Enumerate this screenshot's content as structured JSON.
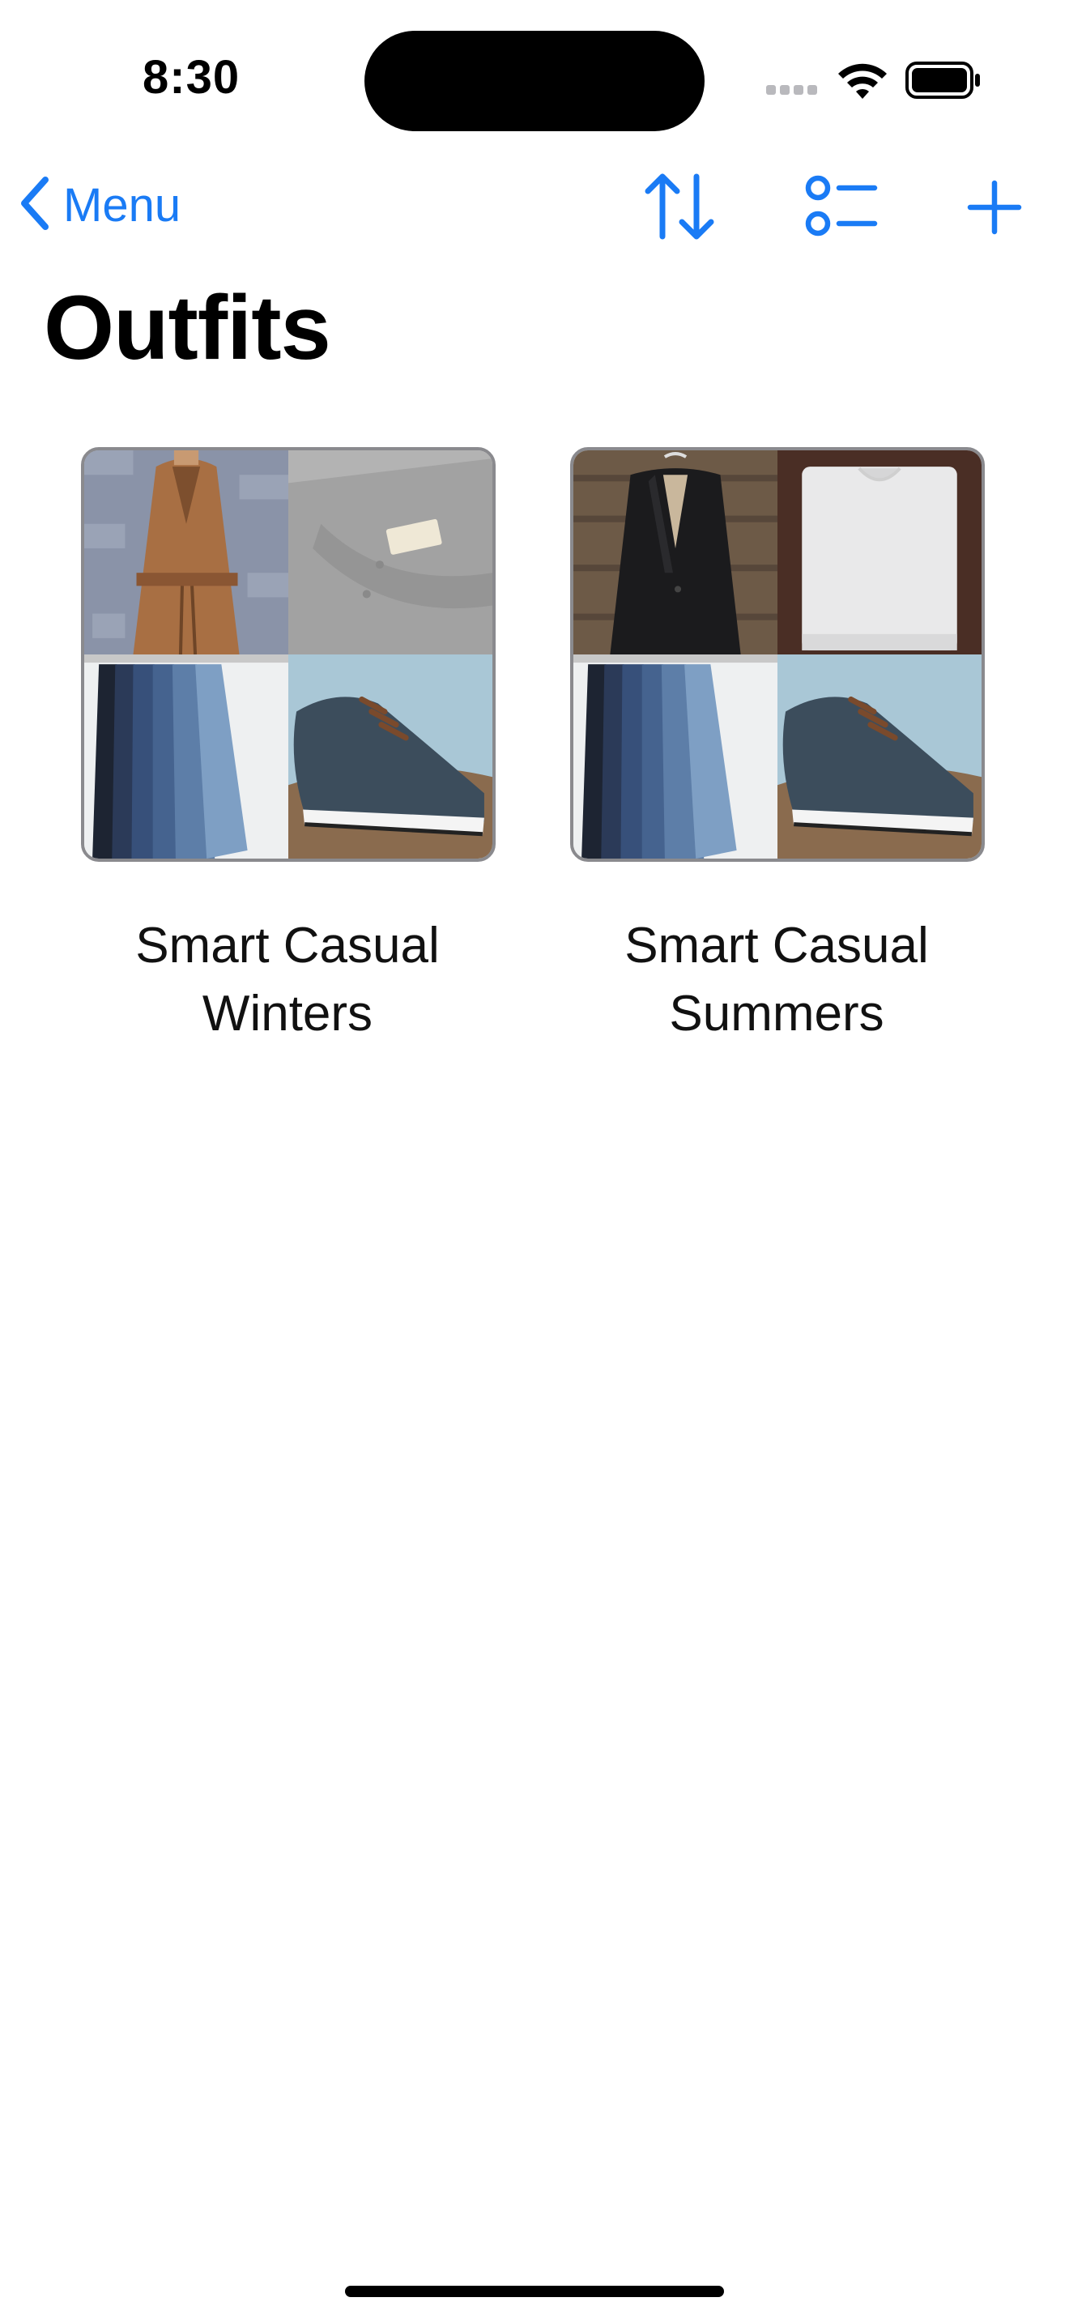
{
  "status_bar": {
    "time": "8:30",
    "signal_icon": "cellular-signal-icon",
    "wifi_icon": "wifi-icon",
    "battery_icon": "battery-icon"
  },
  "nav": {
    "back_label": "Menu",
    "back_icon": "chevron-left-icon",
    "sort_icon": "sort-arrows-icon",
    "list_icon": "list-options-icon",
    "add_icon": "plus-icon",
    "accent_color": "#1a7bf5"
  },
  "page": {
    "title": "Outfits"
  },
  "outfits": [
    {
      "name": "Smart Casual Winters",
      "items": [
        "camel-coat",
        "grey-polo-shirt",
        "blue-jeans",
        "navy-sneakers"
      ]
    },
    {
      "name": "Smart Casual Summers",
      "items": [
        "black-blazer",
        "white-t-shirt",
        "blue-jeans",
        "navy-sneakers"
      ]
    }
  ]
}
